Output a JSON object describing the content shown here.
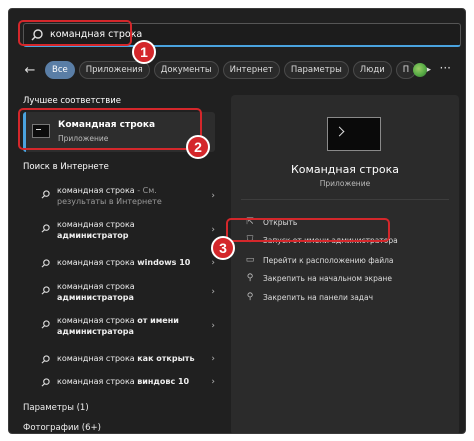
{
  "search": {
    "value": "командная строка",
    "icon": "search-icon"
  },
  "tabs": [
    {
      "label": "Все",
      "active": true
    },
    {
      "label": "Приложения"
    },
    {
      "label": "Документы"
    },
    {
      "label": "Интернет"
    },
    {
      "label": "Параметры"
    },
    {
      "label": "Люди"
    },
    {
      "label": "П"
    }
  ],
  "best_match": {
    "heading": "Лучшее соответствие",
    "title": "Командная строка",
    "subtitle": "Приложение"
  },
  "web": {
    "heading": "Поиск в Интернете",
    "items": [
      {
        "q": "командная строка",
        "suffix": " - См. результаты в Интернете"
      },
      {
        "q": "командная строка ",
        "bold": "администратор"
      },
      {
        "q": "командная строка ",
        "bold": "windows 10"
      },
      {
        "q": "командная строка ",
        "bold": "администратора"
      },
      {
        "q": "командная строка ",
        "bold": "от имени администратора"
      },
      {
        "q": "командная строка ",
        "bold": "как открыть"
      },
      {
        "q": "командная строка ",
        "bold": "виндовс 10"
      }
    ]
  },
  "sections": {
    "settings": "Параметры (1)",
    "photos": "Фотографии (6+)"
  },
  "detail": {
    "title": "Командная строка",
    "subtitle": "Приложение",
    "actions": [
      {
        "label": "Открыть",
        "icon": "open-icon"
      },
      {
        "label": "Запуск от имени администратора",
        "icon": "shield-icon"
      },
      {
        "label": "Перейти к расположению файла",
        "icon": "folder-icon"
      },
      {
        "label": "Закрепить на начальном экране",
        "icon": "pin-icon"
      },
      {
        "label": "Закрепить на панели задач",
        "icon": "pin-icon"
      }
    ]
  },
  "badges": [
    "1",
    "2",
    "3"
  ],
  "colors": {
    "highlight": "#d4272b",
    "accent": "#4aa3df",
    "background": "#202020"
  }
}
